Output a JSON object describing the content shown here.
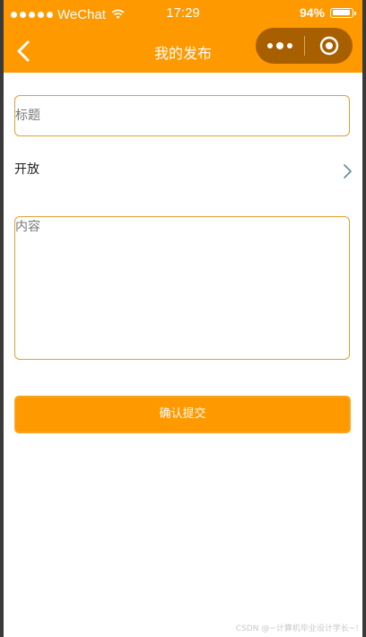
{
  "status_bar": {
    "carrier": "WeChat",
    "time": "17:29",
    "battery_percent": "94%",
    "battery_level": 0.94,
    "signal_dots": 5
  },
  "nav": {
    "title": "我的发布",
    "back_icon": "chevron-left-icon",
    "more_icon": "more-dots-icon",
    "close_icon": "target-circle-icon"
  },
  "form": {
    "title_placeholder": "标题",
    "title_value": "",
    "visibility_value": "开放",
    "content_placeholder": "内容",
    "content_value": "",
    "submit_label": "确认提交"
  },
  "watermark": "CSDN @~计算机毕业设计学长~!",
  "colors": {
    "accent": "#ff9900",
    "capsule": "#a85f00",
    "field_border": "#e0a030"
  }
}
